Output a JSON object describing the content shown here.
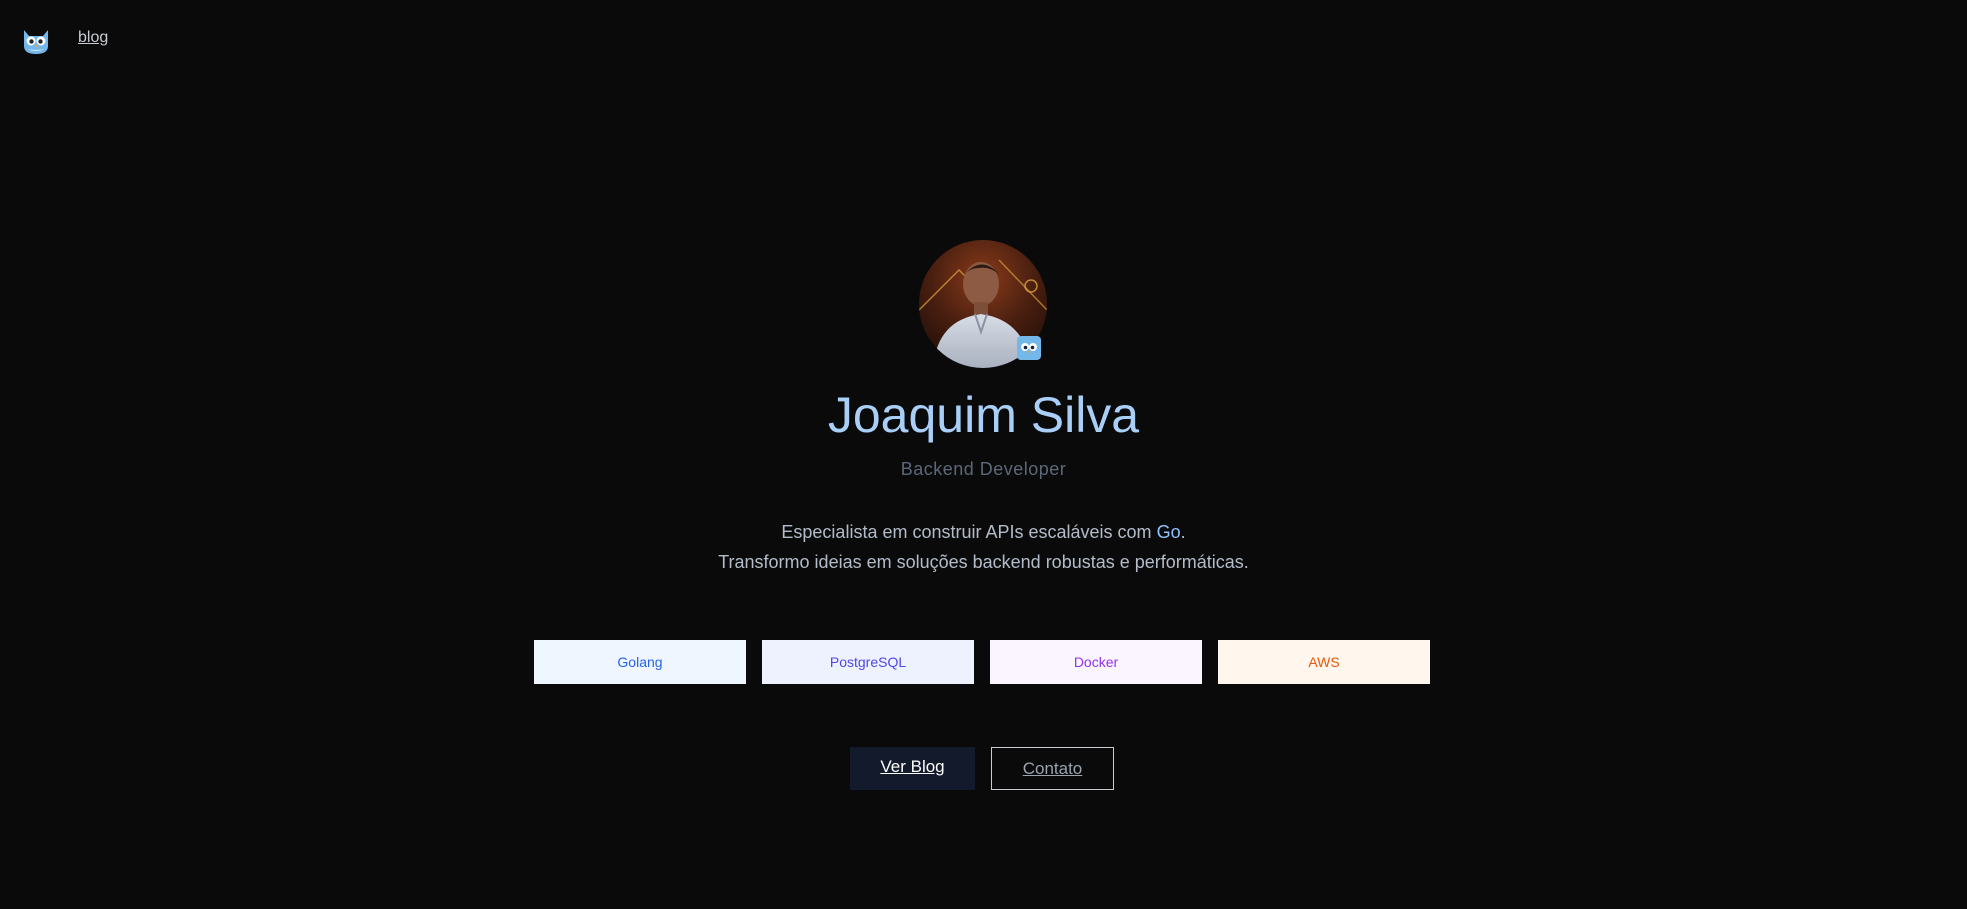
{
  "nav": {
    "logo_icon": "owl-mascot-icon",
    "blog_link": "blog"
  },
  "profile": {
    "avatar_icon": "profile-photo",
    "badge_icon": "owl-badge-icon",
    "name": "Joaquim Silva",
    "role": "Backend Developer",
    "description_line1_prefix": "Especialista em construir APIs escaláveis com ",
    "description_line1_highlight": "Go",
    "description_line1_suffix": ".",
    "description_line2": "Transformo ideias em soluções backend robustas e performáticas."
  },
  "skills": [
    {
      "label": "Golang",
      "bg": "#eff6ff",
      "color": "#2563eb"
    },
    {
      "label": "PostgreSQL",
      "bg": "#eef2ff",
      "color": "#4f46e5"
    },
    {
      "label": "Docker",
      "bg": "#faf5ff",
      "color": "#9333ea"
    },
    {
      "label": "AWS",
      "bg": "#fff7ed",
      "color": "#ea580c"
    }
  ],
  "actions": {
    "blog_button": "Ver Blog",
    "contact_button": "Contato"
  },
  "colors": {
    "background": "#0a0a0b",
    "name": "#a9cff7",
    "accent": "#8ec4ff"
  }
}
